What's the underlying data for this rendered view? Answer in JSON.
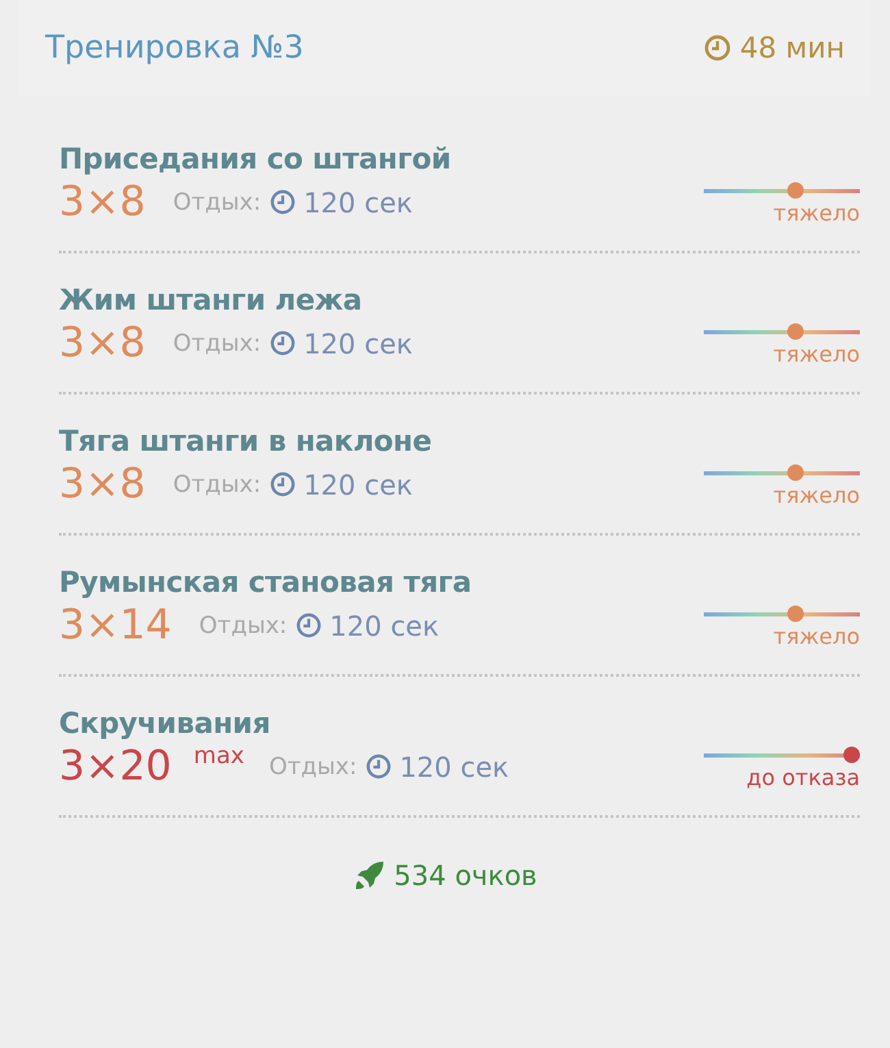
{
  "header": {
    "title": "Тренировка №3",
    "duration": "48 мин"
  },
  "exercises": [
    {
      "name": "Приседания со штангой",
      "sets": "3×8",
      "rest_label": "Отдых:",
      "rest": "120 сек",
      "intensity": {
        "kind": "heavy",
        "label": "тяжело",
        "level": 0.6
      }
    },
    {
      "name": "Жим штанги лежа",
      "sets": "3×8",
      "rest_label": "Отдых:",
      "rest": "120 сек",
      "intensity": {
        "kind": "heavy",
        "label": "тяжело",
        "level": 0.6
      }
    },
    {
      "name": "Тяга штанги в наклоне",
      "sets": "3×8",
      "rest_label": "Отдых:",
      "rest": "120 сек",
      "intensity": {
        "kind": "heavy",
        "label": "тяжело",
        "level": 0.6
      }
    },
    {
      "name": "Румынская становая тяга",
      "sets": "3×14",
      "rest_label": "Отдых:",
      "rest": "120 сек",
      "intensity": {
        "kind": "heavy",
        "label": "тяжело",
        "level": 0.6
      }
    },
    {
      "name": "Скручивания",
      "sets": "3×20",
      "badge": "max",
      "rest_label": "Отдых:",
      "rest": "120 сек",
      "intensity": {
        "kind": "failure",
        "label": "до отказа",
        "level": 1
      }
    }
  ],
  "footer": {
    "points": "534 очков"
  }
}
